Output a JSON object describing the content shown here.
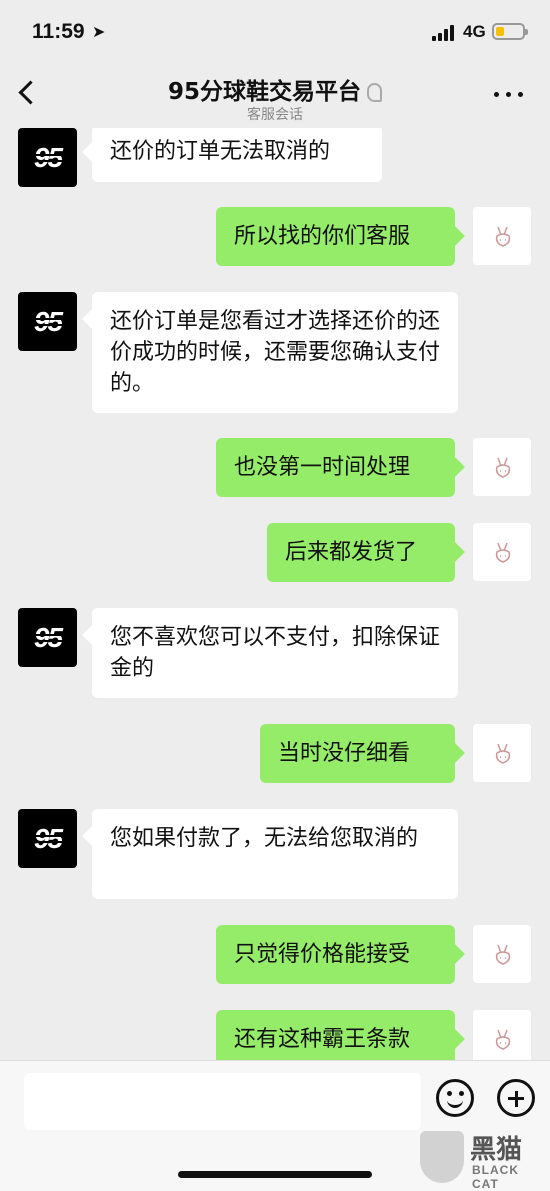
{
  "status_bar": {
    "time": "11:59",
    "location_icon": "location-arrow-icon",
    "network": "4G",
    "battery_color": "#f5c000"
  },
  "nav": {
    "title": "95分球鞋交易平台",
    "subtitle": "客服会话",
    "title_icon": "ear-icon",
    "back_icon": "chevron-left-icon",
    "more_icon": "more-dots-icon"
  },
  "messages": [
    {
      "side": "left",
      "text": "还价的订单无法取消的"
    },
    {
      "side": "right",
      "text": "所以找的你们客服"
    },
    {
      "side": "left",
      "text": "还价订单是您看过才选择还价的还价成功的时候，还需要您确认支付的。"
    },
    {
      "side": "right",
      "text": "也没第一时间处理"
    },
    {
      "side": "right",
      "text": "后来都发货了"
    },
    {
      "side": "left",
      "text": "您不喜欢您可以不支付，扣除保证金的"
    },
    {
      "side": "right",
      "text": "当时没仔细看"
    },
    {
      "side": "left",
      "text": "您如果付款了，无法给您取消的"
    },
    {
      "side": "right",
      "text": "只觉得价格能接受"
    },
    {
      "side": "right",
      "text": "还有这种霸王条款"
    }
  ],
  "colors": {
    "background": "#ededed",
    "bubble_right": "#95ec69",
    "bubble_left": "#ffffff"
  },
  "input_bar": {
    "placeholder": "",
    "emoji_icon": "emoji-icon",
    "plus_icon": "plus-icon"
  },
  "watermark": {
    "title": "黑猫",
    "subtitle": "BLACK CAT"
  }
}
